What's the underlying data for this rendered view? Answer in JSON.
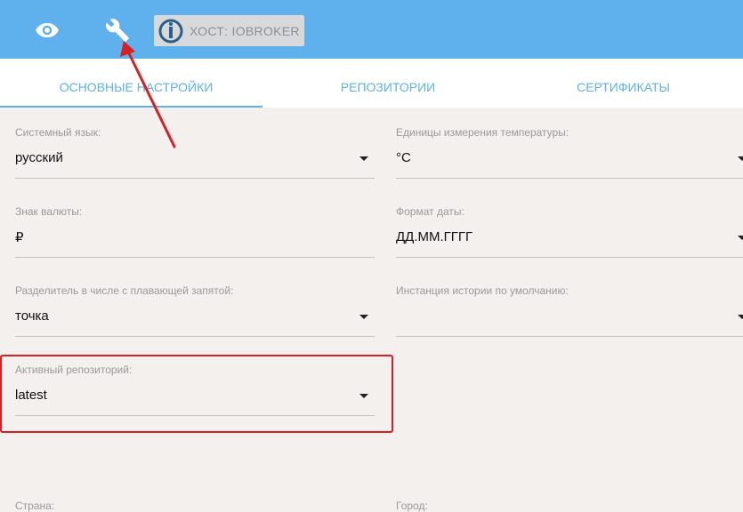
{
  "header": {
    "view_icon": "eye-icon",
    "settings_icon": "wrench-icon",
    "host_logo": "iobroker-logo-icon",
    "host_label": "ХОСТ: IOBROKER"
  },
  "tabs": [
    {
      "label": "ОСНОВНЫЕ НАСТРОЙКИ",
      "active": true
    },
    {
      "label": "РЕПОЗИТОРИИ",
      "active": false
    },
    {
      "label": "СЕРТИФИКАТЫ",
      "active": false
    }
  ],
  "fields": {
    "system_language": {
      "label": "Системный язык:",
      "value": "русский"
    },
    "temperature_units": {
      "label": "Единицы измерения температуры:",
      "value": "°C"
    },
    "currency_sign": {
      "label": "Знак валюты:",
      "value": "₽"
    },
    "date_format": {
      "label": "Формат даты:",
      "value": "ДД.ММ.ГГГГ"
    },
    "float_separator": {
      "label": "Разделитель в числе с плавающей запятой:",
      "value": "точка"
    },
    "default_history": {
      "label": "Инстанция истории по умолчанию:",
      "value": ""
    },
    "active_repository": {
      "label": "Активный репозиторий:",
      "value": "latest"
    },
    "country": {
      "label": "Страна:"
    },
    "city": {
      "label": "Город:"
    }
  },
  "colors": {
    "accent": "#5eb1ed",
    "background": "#f3f0ed",
    "highlight": "#d91f26"
  }
}
